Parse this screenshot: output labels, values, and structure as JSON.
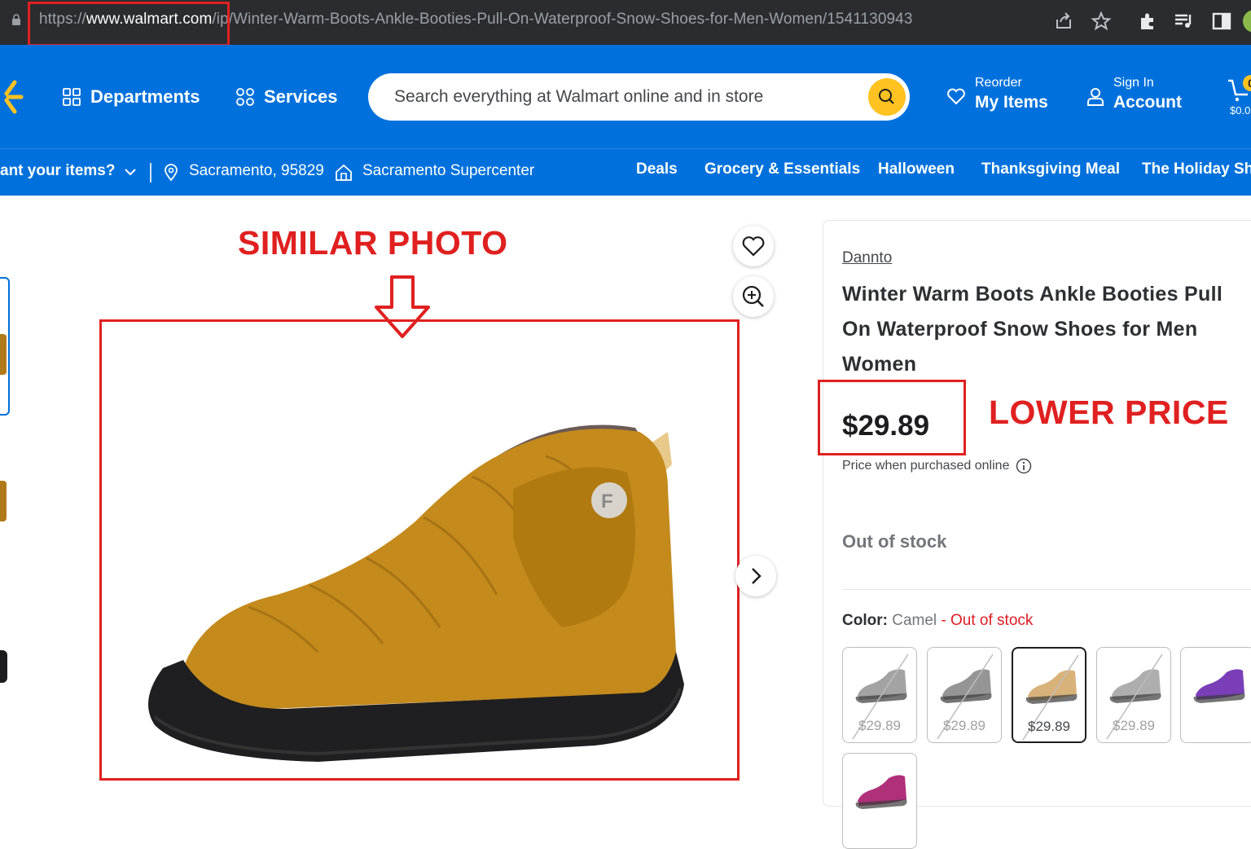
{
  "browser": {
    "url_scheme": "https://",
    "url_host": "www.walmart.com",
    "url_path": "/ip/Winter-Warm-Boots-Ankle-Booties-Pull-On-Waterproof-Snow-Shoes-for-Men-Women/1541130943"
  },
  "header": {
    "departments_label": "Departments",
    "services_label": "Services",
    "search_placeholder": "Search everything at Walmart online and in store",
    "reorder_small": "Reorder",
    "reorder_big": "My Items",
    "signin_small": "Sign In",
    "signin_big": "Account",
    "cart_amount": "$0.0",
    "cart_count": "0"
  },
  "subbar": {
    "pickup_prompt": "ant your items?",
    "location": "Sacramento, 95829",
    "store": "Sacramento Supercenter",
    "categories": [
      "Deals",
      "Grocery & Essentials",
      "Halloween",
      "Thanksgiving Meal",
      "The Holiday Sho"
    ]
  },
  "annotations": {
    "similar_photo": "SIMILAR PHOTO",
    "lower_price": "LOWER PRICE"
  },
  "product": {
    "brand": "Dannto",
    "title_lines": [
      "Winter Warm Boots Ankle Booties Pull",
      "On Waterproof Snow Shoes for Men",
      "Women"
    ],
    "price": "$29.89",
    "price_note": "Price when purchased online",
    "stock_status": "Out of stock",
    "color_label": "Color:",
    "color_value": "Camel",
    "color_sep": "-",
    "color_stock": "Out of stock",
    "swatches": [
      {
        "price": "$29.89",
        "color": "#8c8c8c"
      },
      {
        "price": "$29.89",
        "color": "#7a7a7a"
      },
      {
        "price": "$29.89",
        "color": "#d9b27a"
      },
      {
        "price": "$29.89",
        "color": "#9a9a9a"
      },
      {
        "price": "",
        "color": "#7a3fb8"
      },
      {
        "price": "",
        "color": "#b0307a"
      }
    ]
  },
  "colors": {
    "walmart_blue": "#0071dc",
    "spark_yellow": "#ffc220",
    "annotation_red": "#e02020",
    "boot_camel": "#c48a1c"
  }
}
